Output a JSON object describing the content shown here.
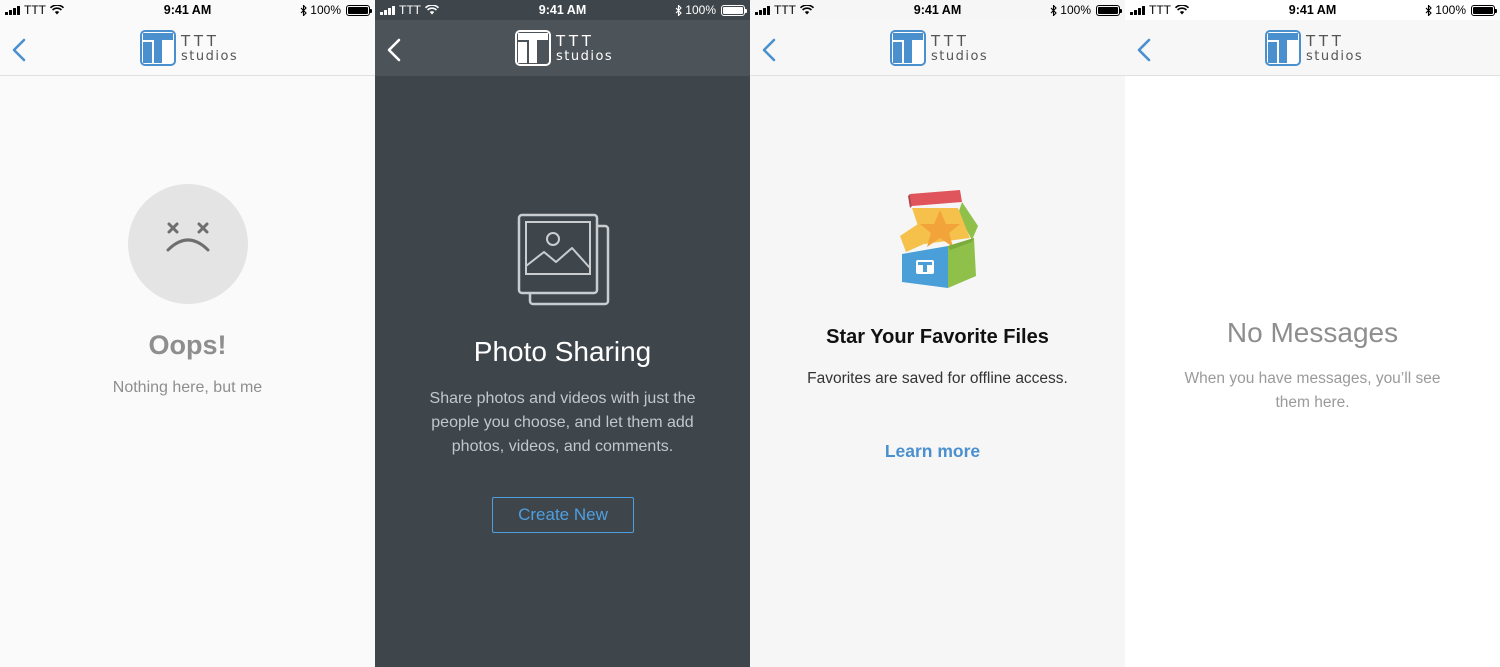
{
  "status_bar": {
    "carrier": "TTT",
    "time": "9:41 AM",
    "battery": "100%"
  },
  "logo": {
    "line1": "TTT",
    "line2": "studios"
  },
  "colors": {
    "accent_blue": "#4a90cf",
    "dark_bg": "#3e464c"
  },
  "screens": [
    {
      "title": "Oops!",
      "subtitle": "Nothing here, but me",
      "icon": "sad-face-icon"
    },
    {
      "title": "Photo Sharing",
      "description": "Share photos and videos with just the people you choose, and let them add photos, videos, and comments.",
      "button": "Create New",
      "icon": "photo-stack-icon"
    },
    {
      "title": "Star Your Favorite Files",
      "subtitle": "Favorites are saved for offline access.",
      "link": "Learn more",
      "icon": "treasure-chest-icon"
    },
    {
      "title": "No Messages",
      "description": "When you have messages, you’ll see them here."
    }
  ]
}
